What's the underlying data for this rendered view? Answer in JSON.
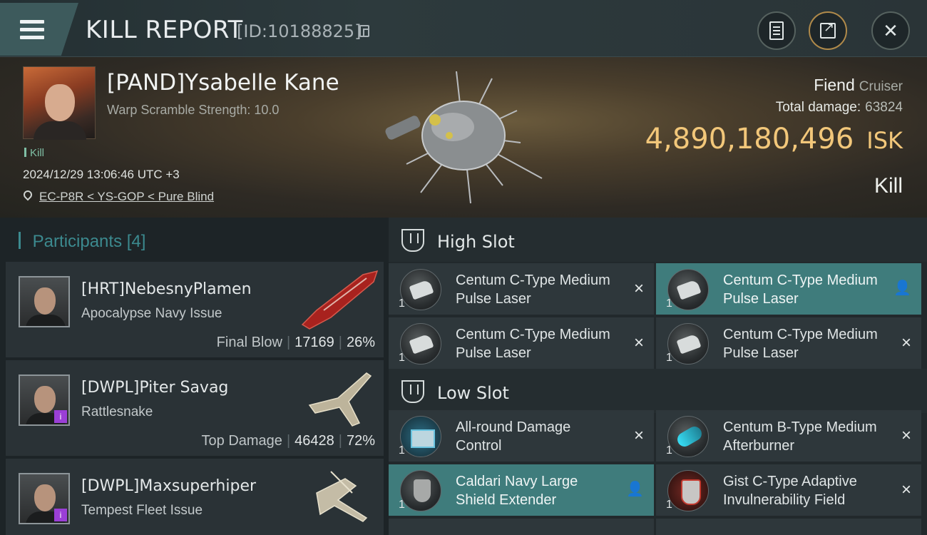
{
  "header": {
    "title": "KILL REPORT",
    "report_id": "[ID:10188825]"
  },
  "victim": {
    "name": "[PAND]Ysabelle Kane",
    "warp_scramble": "Warp Scramble Strength: 10.0",
    "kill_tag": "Kill",
    "datetime": "2024/12/29 13:06:46 UTC +3",
    "location": "EC-P8R < YS-GOP < Pure Blind",
    "ship_name": "Fiend",
    "ship_class": "Cruiser",
    "total_damage_label": "Total damage:",
    "total_damage": "63824",
    "isk_value": "4,890,180,496",
    "isk_unit": "ISK",
    "result": "Kill"
  },
  "participants": {
    "title": "Participants",
    "count": "[4]",
    "rows": [
      {
        "name": "[HRT]NebesnyPlamen",
        "ship": "Apocalypse Navy Issue",
        "label": "Final Blow",
        "damage": "17169",
        "pct": "26%"
      },
      {
        "name": "[DWPL]Piter Savag",
        "ship": "Rattlesnake",
        "label": "Top Damage",
        "damage": "46428",
        "pct": "72%"
      },
      {
        "name": "[DWPL]Maxsuperhiper",
        "ship": "Tempest Fleet Issue"
      }
    ]
  },
  "fitting": {
    "high_slot_title": "High Slot",
    "low_slot_title": "Low Slot",
    "high": [
      {
        "name": "Centum C-Type Medium Pulse Laser",
        "qty": "1",
        "status": "×"
      },
      {
        "name": "Centum C-Type Medium Pulse Laser",
        "qty": "1",
        "status": "👤"
      },
      {
        "name": "Centum C-Type Medium Pulse Laser",
        "qty": "1",
        "status": "×"
      },
      {
        "name": "Centum C-Type Medium Pulse Laser",
        "qty": "1",
        "status": "×"
      }
    ],
    "low": [
      {
        "name": "All-round Damage Control",
        "qty": "1",
        "status": "×"
      },
      {
        "name": "Centum B-Type Medium Afterburner",
        "qty": "1",
        "status": "×"
      },
      {
        "name": "Caldari Navy Large Shield Extender",
        "qty": "1",
        "status": "👤"
      },
      {
        "name": "Gist C-Type Adaptive Invulnerability Field",
        "qty": "1",
        "status": "×"
      }
    ]
  },
  "colors": {
    "accent_teal": "#3f7c7c",
    "isk_gold": "#f2c77a",
    "participant_title": "#3c8a8f"
  }
}
